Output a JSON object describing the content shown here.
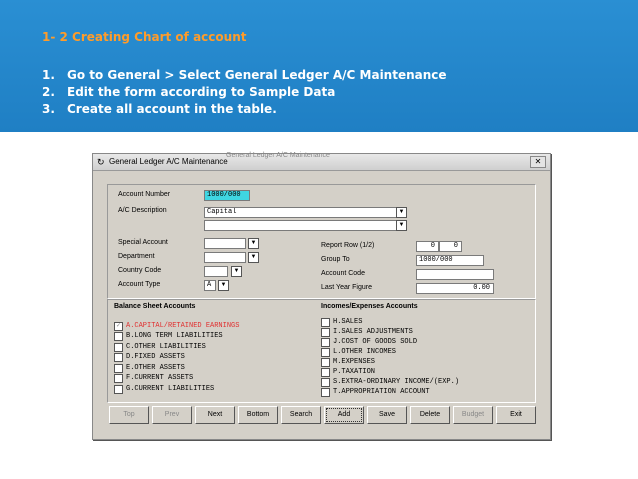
{
  "slide": {
    "title": "1- 2 Creating Chart of account",
    "steps": [
      {
        "num": "1.",
        "text": "Go to General > Select General  Ledger A/C Maintenance"
      },
      {
        "num": "2.",
        "text": "Edit the form according to Sample Data"
      },
      {
        "num": "3.",
        "text": "Create all  account in the table."
      }
    ]
  },
  "window": {
    "title": "General Ledger A/C Maintenance",
    "ghost_title": "General Ledger A/C Maintenance",
    "close": "✕"
  },
  "form": {
    "account_number_label": "Account Number",
    "account_number": "1000/000",
    "description_label": "A/C Description",
    "description_1": "Capital",
    "description_2": "",
    "special_account_label": "Special Account",
    "special_account": "",
    "department_label": "Department",
    "department": "",
    "country_code_label": "Country Code",
    "country_code": "",
    "account_type_label": "Account Type",
    "account_type": "A",
    "report_row_label": "Report Row (1/2)",
    "report_row_1": "0",
    "report_row_2": "0",
    "group_to_label": "Group To",
    "group_to": "1000/000",
    "account_code_label": "Account Code",
    "account_code": "",
    "last_year_label": "Last Year Figure",
    "last_year": "0.00"
  },
  "balance_sheet": {
    "heading": "Balance Sheet Accounts",
    "items": [
      {
        "label": "A.CAPITAL/RETAINED EARNINGS",
        "checked": true
      },
      {
        "label": "B.LONG TERM LIABILITIES",
        "checked": false
      },
      {
        "label": "C.OTHER LIABILITIES",
        "checked": false
      },
      {
        "label": "D.FIXED ASSETS",
        "checked": false
      },
      {
        "label": "E.OTHER ASSETS",
        "checked": false
      },
      {
        "label": "F.CURRENT ASSETS",
        "checked": false
      },
      {
        "label": "G.CURRENT LIABILITIES",
        "checked": false
      }
    ]
  },
  "income_expense": {
    "heading": "Incomes/Expenses Accounts",
    "items": [
      {
        "label": "H.SALES",
        "checked": false
      },
      {
        "label": "I.SALES ADJUSTMENTS",
        "checked": false
      },
      {
        "label": "J.COST OF GOODS SOLD",
        "checked": false
      },
      {
        "label": "L.OTHER INCOMES",
        "checked": false
      },
      {
        "label": "M.EXPENSES",
        "checked": false
      },
      {
        "label": "P.TAXATION",
        "checked": false
      },
      {
        "label": "S.EXTRA-ORDINARY INCOME/(EXP.)",
        "checked": false
      },
      {
        "label": "T.APPROPRIATION ACCOUNT",
        "checked": false
      }
    ]
  },
  "toolbar": {
    "top": "Top",
    "prev": "Prev",
    "next": "Next",
    "bottom": "Bottom",
    "search": "Search",
    "add": "Add",
    "save": "Save",
    "delete": "Delete",
    "budget": "Budget",
    "exit": "Exit"
  },
  "icons": {
    "dropdown": "▼",
    "check": "✓",
    "window_icon": "↻"
  },
  "colors": {
    "banner": "#1f7fc4",
    "title_orange": "#ff9c2a",
    "highlight_field": "#3fd6e2",
    "selected_red": "#e03030"
  }
}
